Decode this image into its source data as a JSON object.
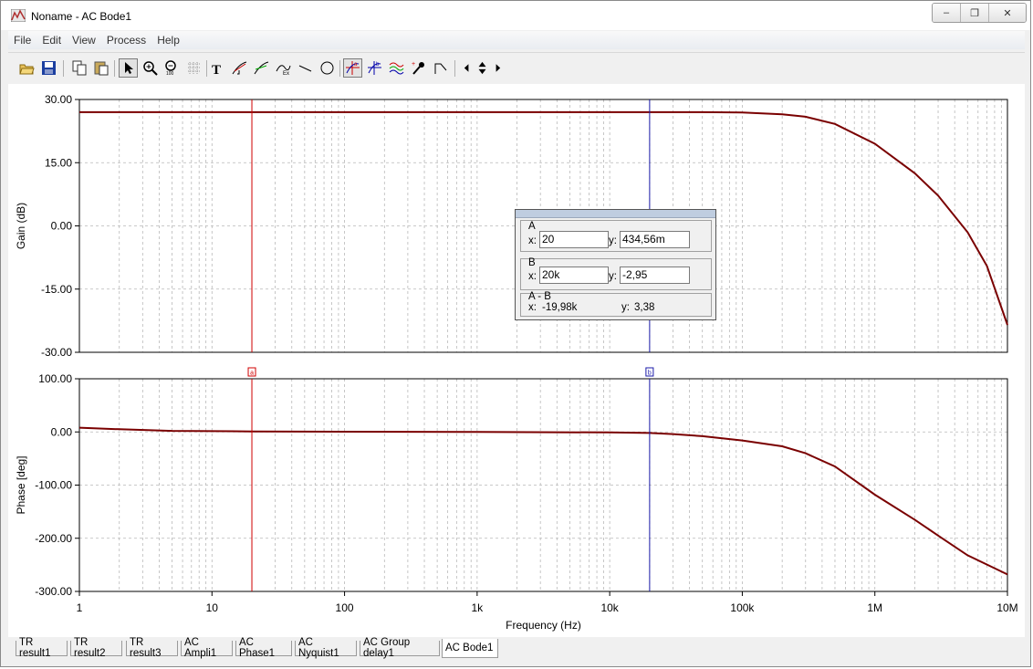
{
  "window": {
    "title": "Noname - AC Bode1",
    "minimize_icon": "minimize-icon",
    "restore_icon": "restore-icon",
    "close_icon": "close-icon"
  },
  "menu": [
    "File",
    "Edit",
    "View",
    "Process",
    "Help"
  ],
  "toolbar": [
    "open-icon",
    "save-icon",
    "copy-icon",
    "paste-icon",
    "pointer-icon",
    "zoom-in-icon",
    "zoom-out-icon",
    "grid-icon",
    "text-icon",
    "tangent-icon",
    "slope-icon",
    "curve-icon",
    "line-icon",
    "circle-icon",
    "cursor-a-icon",
    "cursor-b-icon",
    "waves-icon",
    "probe-icon",
    "step-icon",
    "arrow-left-icon",
    "arrow-updown-icon",
    "arrow-right-icon"
  ],
  "colors": {
    "trace": "#7a0000",
    "cursor_a": "#d00000",
    "cursor_b": "#1a1aa8",
    "grid": "#b8b8b8"
  },
  "chart_data": [
    {
      "type": "line",
      "ylabel": "Gain (dB)",
      "ylim": [
        -30,
        30
      ],
      "yticks": [
        "30.00",
        "15.00",
        "0.00",
        "-15.00",
        "-30.00"
      ],
      "x_scale": "log",
      "xlim": [
        1,
        10000000
      ],
      "grid": true,
      "series": [
        {
          "x": [
            1,
            100,
            10000,
            50000,
            100000,
            200000,
            300000,
            500000,
            1000000,
            2000000,
            3000000,
            5000000,
            7000000,
            10000000
          ],
          "values": [
            27,
            27,
            27,
            27,
            26.9,
            26.5,
            25.9,
            24.2,
            19.5,
            12.5,
            7.2,
            -1.5,
            -9.5,
            -23.5
          ]
        }
      ]
    },
    {
      "type": "line",
      "ylabel": "Phase [deg]",
      "xlabel": "Frequency (Hz)",
      "ylim": [
        -300,
        100
      ],
      "yticks": [
        "100.00",
        "0.00",
        "-100.00",
        "-200.00",
        "-300.00"
      ],
      "x_scale": "log",
      "xlim": [
        1,
        10000000
      ],
      "xticks": [
        "1",
        "10",
        "100",
        "1k",
        "10k",
        "100k",
        "1M",
        "10M"
      ],
      "grid": true,
      "series": [
        {
          "x": [
            1,
            2,
            5,
            20,
            100,
            1000,
            10000,
            20000,
            30000,
            50000,
            100000,
            200000,
            300000,
            500000,
            1000000,
            2000000,
            3000000,
            5000000,
            10000000
          ],
          "values": [
            8,
            5,
            2,
            1,
            0.5,
            0,
            -1,
            -2,
            -4,
            -8,
            -16,
            -27,
            -40,
            -65,
            -118,
            -165,
            -195,
            -232,
            -268
          ]
        }
      ]
    }
  ],
  "cursors": {
    "a_label": "a",
    "b_label": "b",
    "a_x": 20,
    "b_x": 20000
  },
  "cursor_panel": {
    "a_title": "A",
    "a_x_label": "x:",
    "a_x": "20",
    "a_y_label": "y:",
    "a_y": "434,56m",
    "b_title": "B",
    "b_x_label": "x:",
    "b_x": "20k",
    "b_y_label": "y:",
    "b_y": "-2,95",
    "ab_title": "A - B",
    "ab_x_label": "x:",
    "ab_x": "-19,98k",
    "ab_y_label": "y:",
    "ab_y": "3,38"
  },
  "tabs": [
    "TR result1",
    "TR result2",
    "TR result3",
    "AC Ampli1",
    "AC Phase1",
    "AC Nyquist1",
    "AC Group delay1",
    "AC Bode1"
  ],
  "active_tab": "AC Bode1"
}
